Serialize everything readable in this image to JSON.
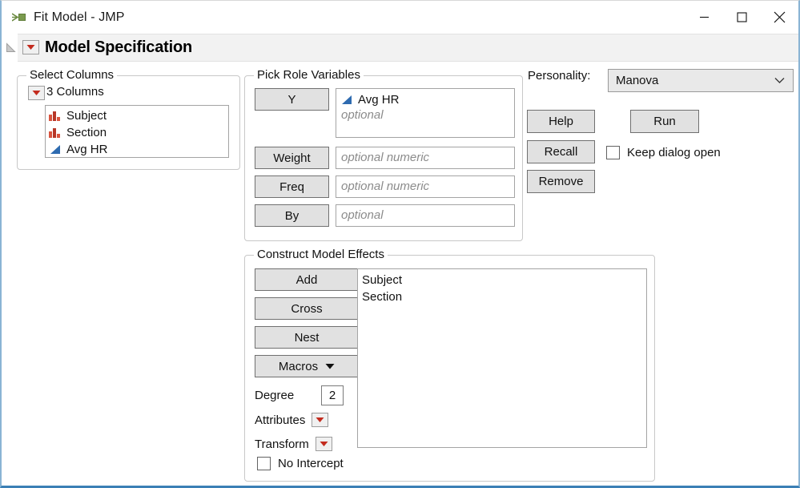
{
  "window": {
    "title": "Fit Model - JMP",
    "icon": "jmp-fit-model-icon",
    "controls": {
      "minimize": "minimize-icon",
      "maximize": "maximize-icon",
      "close": "close-icon"
    }
  },
  "model_specification": {
    "title": "Model Specification",
    "disclosure_icon": "disclosure-triangle-icon",
    "menu_icon": "red-triangle-menu-icon"
  },
  "select_columns": {
    "legend": "Select Columns",
    "column_count_label": "3 Columns",
    "menu_icon": "red-triangle-menu-icon",
    "columns": [
      {
        "name": "Subject",
        "type": "nominal",
        "icon": "nominal-bars-icon"
      },
      {
        "name": "Section",
        "type": "nominal",
        "icon": "nominal-bars-icon"
      },
      {
        "name": "Avg HR",
        "type": "continuous",
        "icon": "continuous-triangle-icon"
      }
    ]
  },
  "pick_role_variables": {
    "legend": "Pick Role Variables",
    "y": {
      "button_label": "Y",
      "assigned": [
        {
          "name": "Avg HR",
          "icon": "continuous-triangle-icon"
        }
      ],
      "placeholder": "optional"
    },
    "weight": {
      "button_label": "Weight",
      "value": "",
      "placeholder": "optional numeric"
    },
    "freq": {
      "button_label": "Freq",
      "value": "",
      "placeholder": "optional numeric"
    },
    "by": {
      "button_label": "By",
      "value": "",
      "placeholder": "optional"
    }
  },
  "personality": {
    "label": "Personality:",
    "selected": "Manova",
    "chevron_icon": "chevron-down-icon"
  },
  "actions": {
    "help": "Help",
    "recall": "Recall",
    "remove": "Remove",
    "run": "Run",
    "keep_dialog_open": {
      "label": "Keep dialog open",
      "checked": false
    }
  },
  "construct_model_effects": {
    "legend": "Construct Model Effects",
    "buttons": {
      "add": "Add",
      "cross": "Cross",
      "nest": "Nest",
      "macros": "Macros"
    },
    "degree": {
      "label": "Degree",
      "value": "2"
    },
    "attributes": {
      "label": "Attributes",
      "menu_icon": "red-triangle-menu-icon"
    },
    "transform": {
      "label": "Transform",
      "menu_icon": "red-triangle-menu-icon"
    },
    "no_intercept": {
      "label": "No Intercept",
      "checked": false
    },
    "effects": [
      "Subject",
      "Section"
    ]
  },
  "colors": {
    "nominal_icon": "#c0392b",
    "continuous_icon": "#2e6bb0",
    "red_menu_triangle": "#c32b1e",
    "window_accent": "#3b7fb5",
    "button_face": "#e1e1e1",
    "header_strip": "#f2f2f2"
  }
}
